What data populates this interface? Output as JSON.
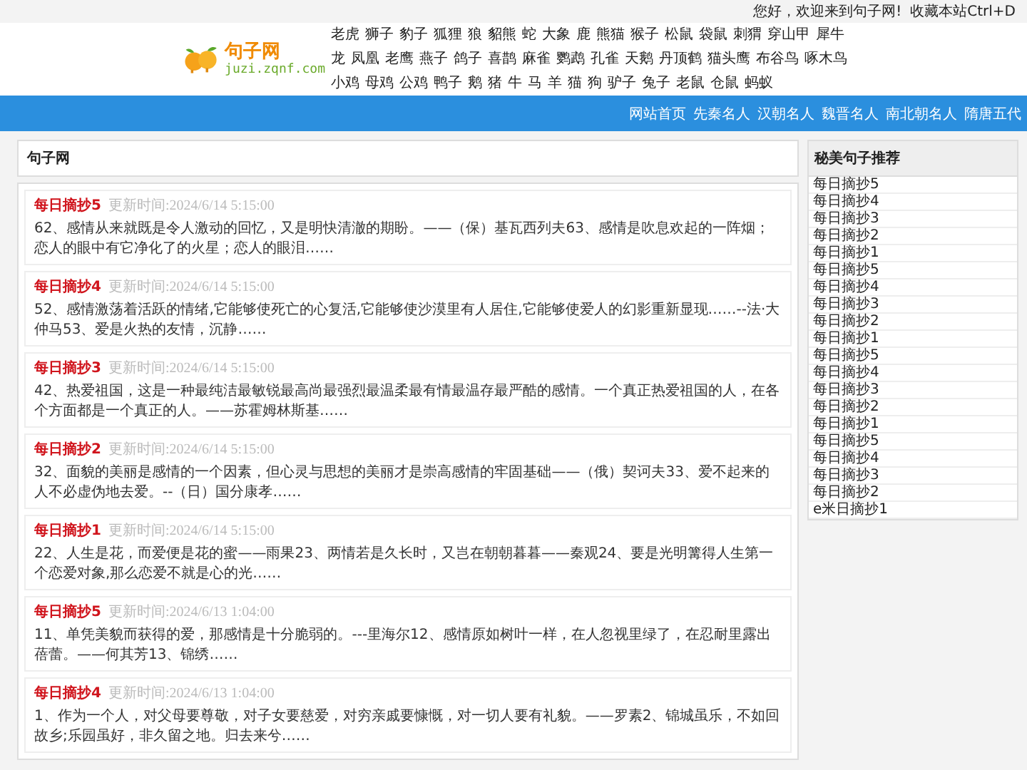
{
  "top_bar": {
    "greeting": "您好，欢迎来到句子网!",
    "bookmark": "收藏本站Ctrl+D"
  },
  "logo": {
    "name": "句子网",
    "domain": "juzi.zqnf.com"
  },
  "tag_lines": [
    [
      "老虎",
      "狮子",
      "豹子",
      "狐狸",
      "狼",
      "貂熊",
      "蛇",
      "大象",
      "鹿",
      "熊猫",
      "猴子",
      "松鼠",
      "袋鼠",
      "刺猬",
      "穿山甲",
      "犀牛"
    ],
    [
      "龙",
      "凤凰",
      "老鹰",
      "燕子",
      "鸽子",
      "喜鹊",
      "麻雀",
      "鹦鹉",
      "孔雀",
      "天鹅",
      "丹顶鹤",
      "猫头鹰",
      "布谷鸟",
      "啄木鸟"
    ],
    [
      "小鸡",
      "母鸡",
      "公鸡",
      "鸭子",
      "鹅",
      "猪",
      "牛",
      "马",
      "羊",
      "猫",
      "狗",
      "驴子",
      "兔子",
      "老鼠",
      "仓鼠",
      "蚂蚁"
    ]
  ],
  "nav": [
    "网站首页",
    "先秦名人",
    "汉朝名人",
    "魏晋名人",
    "南北朝名人",
    "隋唐五代"
  ],
  "main": {
    "heading": "句子网",
    "articles": [
      {
        "title": "每日摘抄5",
        "updated": "更新时间:2024/6/14 5:15:00",
        "excerpt": "62、感情从来就既是令人激动的回忆，又是明快清澈的期盼。——（保）基瓦西列夫63、感情是吹息欢起的一阵烟；恋人的眼中有它净化了的火星；恋人的眼泪……"
      },
      {
        "title": "每日摘抄4",
        "updated": "更新时间:2024/6/14 5:15:00",
        "excerpt": "52、感情激荡着活跃的情绪,它能够使死亡的心复活,它能够使沙漠里有人居住,它能够使爱人的幻影重新显现……--法·大仲马53、爱是火热的友情，沉静……"
      },
      {
        "title": "每日摘抄3",
        "updated": "更新时间:2024/6/14 5:15:00",
        "excerpt": "42、热爱祖国，这是一种最纯洁最敏锐最高尚最强烈最温柔最有情最温存最严酷的感情。一个真正热爱祖国的人，在各个方面都是一个真正的人。——苏霍姆林斯基……"
      },
      {
        "title": "每日摘抄2",
        "updated": "更新时间:2024/6/14 5:15:00",
        "excerpt": "32、面貌的美丽是感情的一个因素，但心灵与思想的美丽才是崇高感情的牢固基础——（俄）契诃夫33、爱不起来的人不必虚伪地去爱。--（日）国分康孝……"
      },
      {
        "title": "每日摘抄1",
        "updated": "更新时间:2024/6/14 5:15:00",
        "excerpt": "22、人生是花，而爱便是花的蜜——雨果23、两情若是久长时，又岂在朝朝暮暮——秦观24、要是光明篝得人生第一个恋爱对象,那么恋爱不就是心的光……"
      },
      {
        "title": "每日摘抄5",
        "updated": "更新时间:2024/6/13 1:04:00",
        "excerpt": "11、单凭美貌而获得的爱，那感情是十分脆弱的。---里海尔12、感情原如树叶一样，在人忽视里绿了，在忍耐里露出蓓蕾。——何其芳13、锦绣……"
      },
      {
        "title": "每日摘抄4",
        "updated": "更新时间:2024/6/13 1:04:00",
        "excerpt": "1、作为一个人，对父母要尊敬，对子女要慈爱，对穷亲戚要慷慨，对一切人要有礼貌。——罗素2、锦城虽乐，不如回故乡;乐园虽好，非久留之地。归去来兮……"
      }
    ]
  },
  "sidebar": {
    "heading": "秘美句子推荐",
    "items": [
      "每日摘抄5",
      "每日摘抄4",
      "每日摘抄3",
      "每日摘抄2",
      "每日摘抄1",
      "每日摘抄5",
      "每日摘抄4",
      "每日摘抄3",
      "每日摘抄2",
      "每日摘抄1",
      "每日摘抄5",
      "每日摘抄4",
      "每日摘抄3",
      "每日摘抄2",
      "每日摘抄1",
      "每日摘抄5",
      "每日摘抄4",
      "每日摘抄3",
      "每日摘抄2",
      "e米日摘抄1"
    ]
  }
}
